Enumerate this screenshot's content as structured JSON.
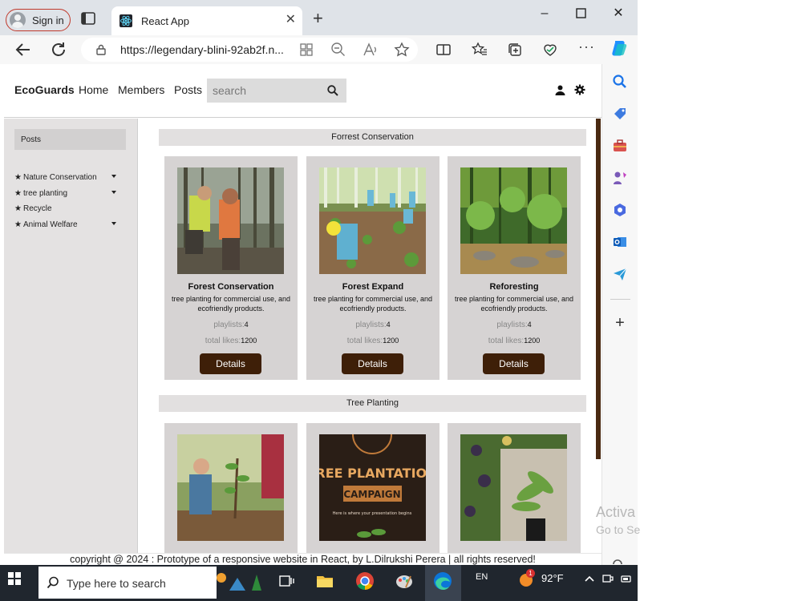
{
  "browser": {
    "signin_label": "Sign in",
    "tab_title": "React App",
    "url": "https://legendary-blini-92ab2f.n..."
  },
  "site": {
    "brand": "EcoGuards",
    "nav": [
      "Home",
      "Members",
      "Posts"
    ],
    "search_placeholder": "search"
  },
  "sidebar": {
    "posts_label": "Posts",
    "categories": [
      "Nature Conservation",
      "tree planting",
      "Recycle",
      "Animal Welfare"
    ]
  },
  "sections": [
    {
      "title": "Forrest Conservation",
      "cards": [
        {
          "title": "Forest Conservation",
          "description": "tree planting for commercial use, and ecofriendly products.",
          "playlists_label": "playlists:",
          "playlists": "4",
          "likes_label": "total likes:",
          "likes": "1200",
          "button": "Details"
        },
        {
          "title": "Forest Expand",
          "description": "tree planting for commercial use, and ecofriendly products.",
          "playlists_label": "playlists:",
          "playlists": "4",
          "likes_label": "total likes:",
          "likes": "1200",
          "button": "Details"
        },
        {
          "title": "Reforesting",
          "description": "tree planting for commercial use, and ecofriendly products.",
          "playlists_label": "playlists:",
          "playlists": "4",
          "likes_label": "total likes:",
          "likes": "1200",
          "button": "Details"
        }
      ]
    },
    {
      "title": "Tree Planting",
      "poster_line1": "TREE PLANTATION",
      "poster_line2": "CAMPAIGN",
      "poster_line3": "Here is where your presentation begins"
    }
  ],
  "footer": "copyright @ 2024 : Prototype of a responsive website in React, by L.Dilrukshi Perera | all rights reserved!",
  "watermark": {
    "line1": "Activa",
    "line2": "Go to Se"
  },
  "taskbar": {
    "search_text": "Type here to search",
    "language": "EN",
    "weather": "92°F",
    "notification_count": "1"
  },
  "colors": {
    "button": "#3e1f08",
    "card": "#d6d3d3",
    "panel": "#e4e2e2",
    "signin_border": "#c0392b"
  }
}
